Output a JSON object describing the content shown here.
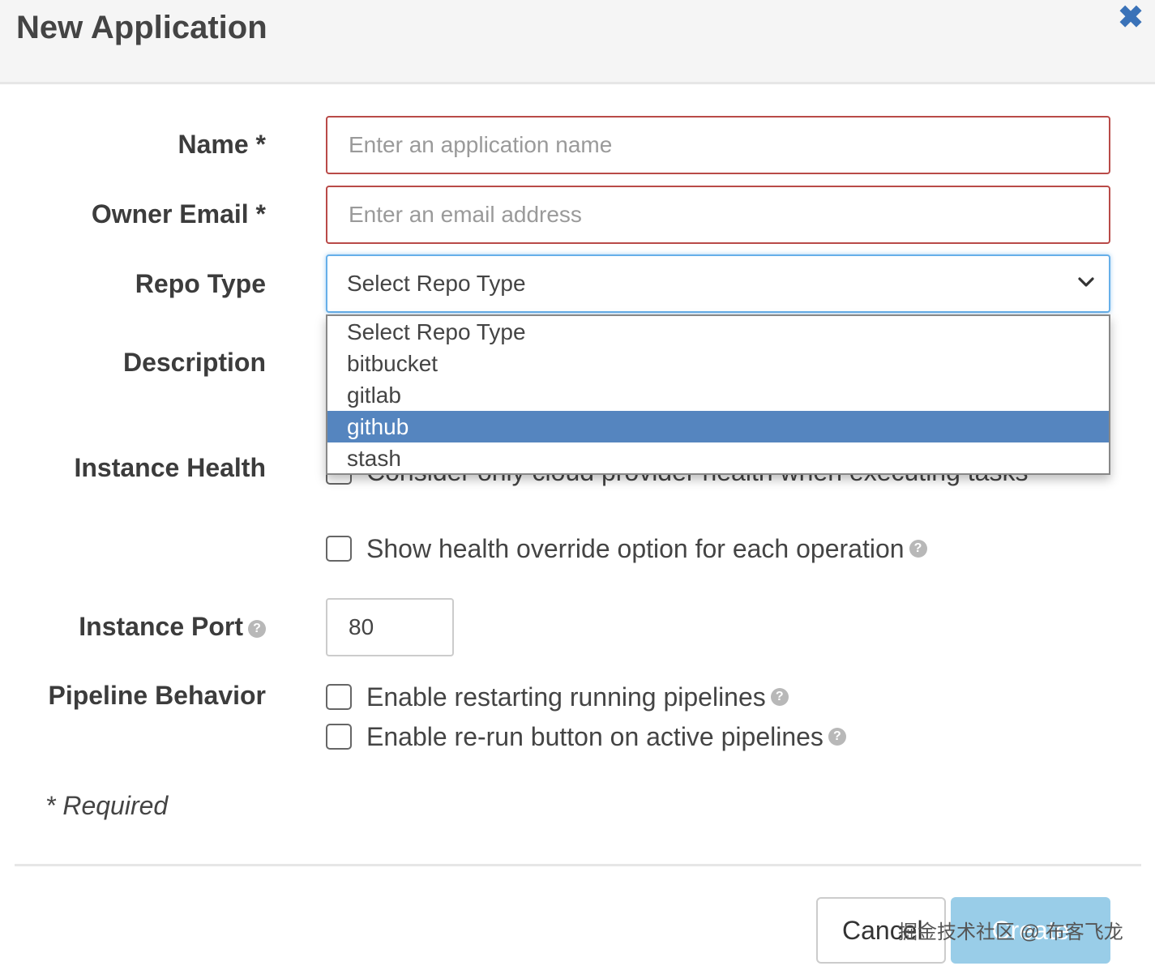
{
  "header": {
    "title": "New Application",
    "close_icon": "close-icon"
  },
  "form": {
    "name_label": "Name *",
    "name_placeholder": "Enter an application name",
    "email_label": "Owner Email *",
    "email_placeholder": "Enter an email address",
    "repo_label": "Repo Type",
    "repo_selected": "Select Repo Type",
    "repo_options": [
      "Select Repo Type",
      "bitbucket",
      "gitlab",
      "github",
      "stash"
    ],
    "repo_highlighted": "github",
    "description_label": "Description",
    "instance_health_label": "Instance Health",
    "instance_health_option_partial": "Consider only cloud provider health when executing tasks",
    "health_override_option": "Show health override option for each operation",
    "instance_port_label": "Instance Port",
    "instance_port_value": "80",
    "pipeline_label": "Pipeline Behavior",
    "pipeline_restart_option": "Enable restarting running pipelines",
    "pipeline_rerun_option": "Enable re-run button on active pipelines",
    "required_note": "* Required"
  },
  "footer": {
    "cancel_label": "Cancel",
    "create_label": "Create",
    "watermark": "掘金技术社区 @ 布客飞龙"
  },
  "colors": {
    "error_border": "#b94a48",
    "focus_border": "#66afe9",
    "highlight": "#5585bf",
    "close_icon": "#3a72b8",
    "create_button": "#99cde8"
  }
}
